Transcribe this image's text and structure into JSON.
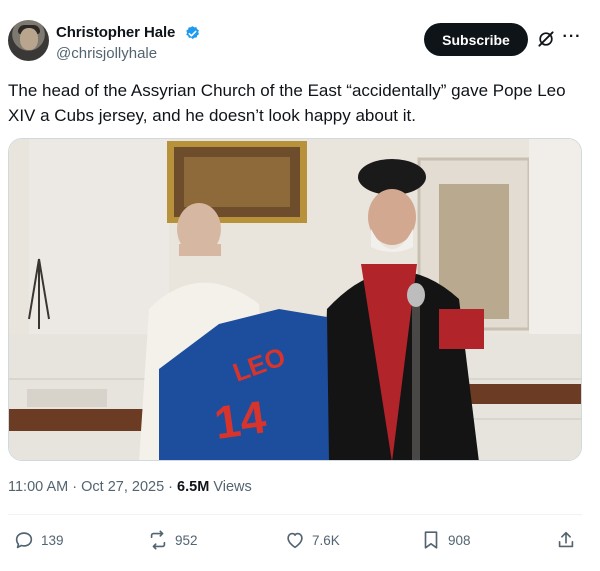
{
  "author": {
    "display_name": "Christopher Hale",
    "handle": "@chrisjollyhale",
    "verified": true,
    "avatar_icon": "avatar"
  },
  "header": {
    "subscribe_label": "Subscribe",
    "grok_icon": "grok-icon",
    "more_icon": "more-icon",
    "more_glyph": "···"
  },
  "tweet": {
    "text": "The head of the Assyrian Church of the East “accidentally” gave Pope Leo XIV a Cubs jersey, and he doesn’t look happy about it.",
    "media": {
      "jersey_name": "LEO",
      "jersey_number": "14",
      "jersey_color": "#1d4e9e",
      "jersey_text_color": "#d9342b"
    }
  },
  "meta": {
    "time": "11:00 AM",
    "date": "Oct 27, 2025",
    "views_count": "6.5M",
    "views_label": "Views",
    "separator": "·"
  },
  "actions": {
    "replies": "139",
    "reposts": "952",
    "likes": "7.6K",
    "bookmarks": "908"
  },
  "colors": {
    "text": "#0f1419",
    "secondary": "#536471",
    "verified": "#1d9bf0",
    "subscribe_bg": "#0f1419"
  }
}
